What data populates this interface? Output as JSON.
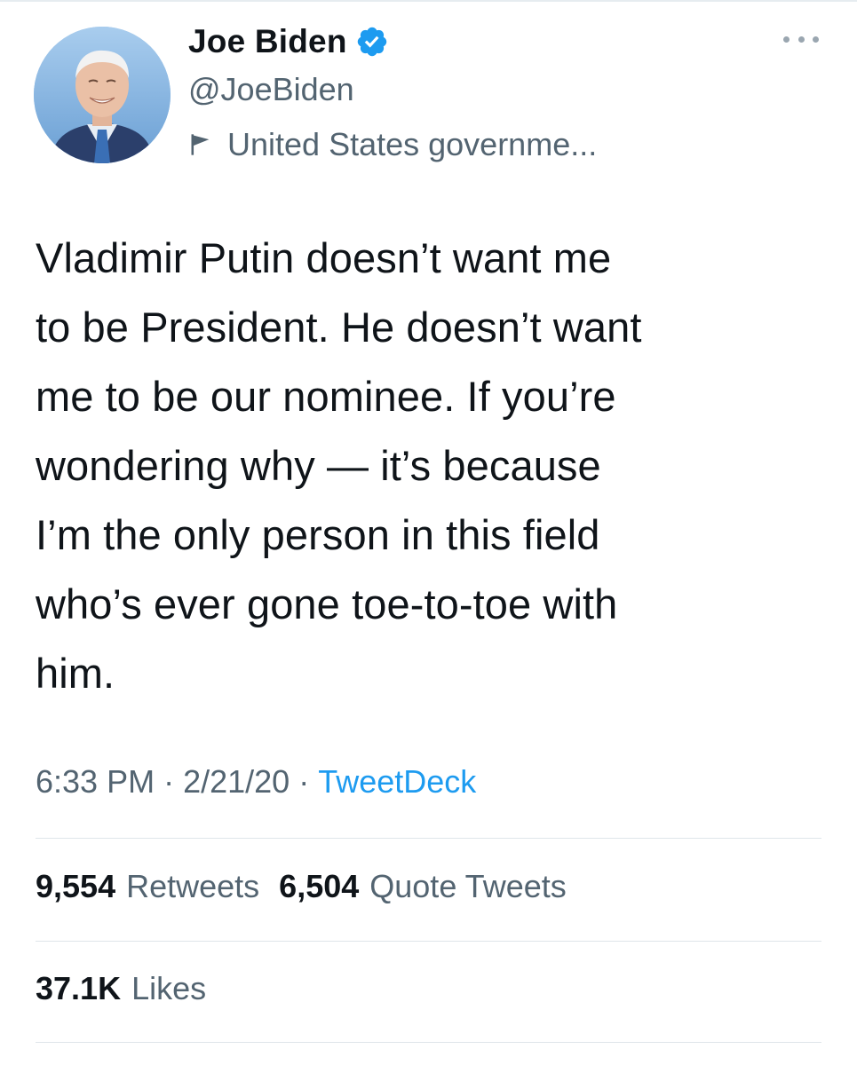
{
  "author": {
    "display_name": "Joe Biden",
    "handle": "@JoeBiden",
    "label": "United States governme...",
    "verified": true
  },
  "tweet": {
    "text": "Vladimir Putin doesn’t want me\nto be President. He doesn’t want\nme to be our nominee. If you’re\nwondering why — it’s because\nI’m the only person in this field\nwho’s ever gone toe-to-toe with\nhim.",
    "time": "6:33 PM",
    "date": "2/21/20",
    "source": "TweetDeck",
    "separator": "·"
  },
  "stats": {
    "retweets_count": "9,554",
    "retweets_label": "Retweets",
    "quote_count": "6,504",
    "quote_label": "Quote Tweets",
    "likes_count": "37.1K",
    "likes_label": "Likes"
  },
  "icons": {
    "verified": "verified-badge-icon",
    "label": "flag-icon",
    "more": "more-options-icon"
  },
  "colors": {
    "text": "#0f1419",
    "secondary": "#536471",
    "accent": "#1d9bf0"
  }
}
